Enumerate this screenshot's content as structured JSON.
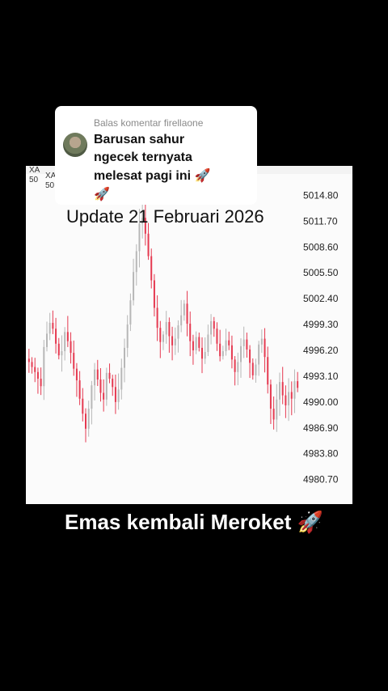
{
  "comment": {
    "header": "Balas komentar firellaone",
    "line1": "Barusan sahur",
    "line2": "ngecek ternyata",
    "line3": "melesat pagi ini",
    "emoji": "🚀"
  },
  "overlay": {
    "update_title": "Update 21 Februari 2026",
    "caption": "Emas kembali Meroket",
    "caption_emoji": "🚀"
  },
  "ticker": {
    "line1a": "XA",
    "line1b": "XA",
    "line2a": "50",
    "line2b": "50"
  },
  "colors": {
    "up": "#b7b7b7",
    "down": "#e53950",
    "panel": "#fbfbfb"
  },
  "chart_data": {
    "type": "candlestick",
    "y_ticks": [
      "5014.80",
      "5011.70",
      "5008.60",
      "5005.50",
      "5002.40",
      "4999.30",
      "4996.20",
      "4993.10",
      "4990.00",
      "4986.90",
      "4983.80",
      "4980.70"
    ],
    "ylim": [
      4979.5,
      5016.2
    ],
    "series": [
      {
        "name": "",
        "close": [
          4994.8,
          4994.2,
          4993.6,
          4992.8,
          4991.9,
          4996.6,
          4998.2,
          4999.5,
          4998.8,
          4997.0,
          4995.6,
          4996.1,
          4998.4,
          4997.3,
          4995.9,
          4994.0,
          4992.6,
          4990.4,
          4988.6,
          4986.8,
          4989.2,
          4992.0,
          4993.9,
          4992.7,
          4991.1,
          4990.3,
          4993.5,
          4992.8,
          4991.8,
          4990.0,
          4991.5,
          4994.1,
          4996.5,
          4999.3,
          5002.2,
          5005.6,
          5008.1,
          5011.4,
          5012.1,
          5010.2,
          5007.5,
          5004.6,
          5001.3,
          4998.9,
          4997.2,
          4998.1,
          4999.6,
          4997.9,
          4996.8,
          4997.6,
          4999.2,
          5000.4,
          5001.8,
          4999.4,
          4997.3,
          4996.2,
          4997.8,
          4996.5,
          4995.2,
          4996.0,
          4998.1,
          4999.7,
          4998.8,
          4997.0,
          4995.5,
          4996.1,
          4997.4,
          4996.8,
          4995.1,
          4993.6,
          4994.8,
          4996.7,
          4997.5,
          4996.3,
          4994.7,
          4993.2,
          4994.5,
          4996.9,
          4997.6,
          4995.4,
          4992.1,
          4989.2,
          4987.9,
          4990.3,
          4992.4,
          4990.8,
          4989.6,
          4991.2,
          4990.4,
          4992.5,
          4991.7
        ]
      }
    ]
  }
}
